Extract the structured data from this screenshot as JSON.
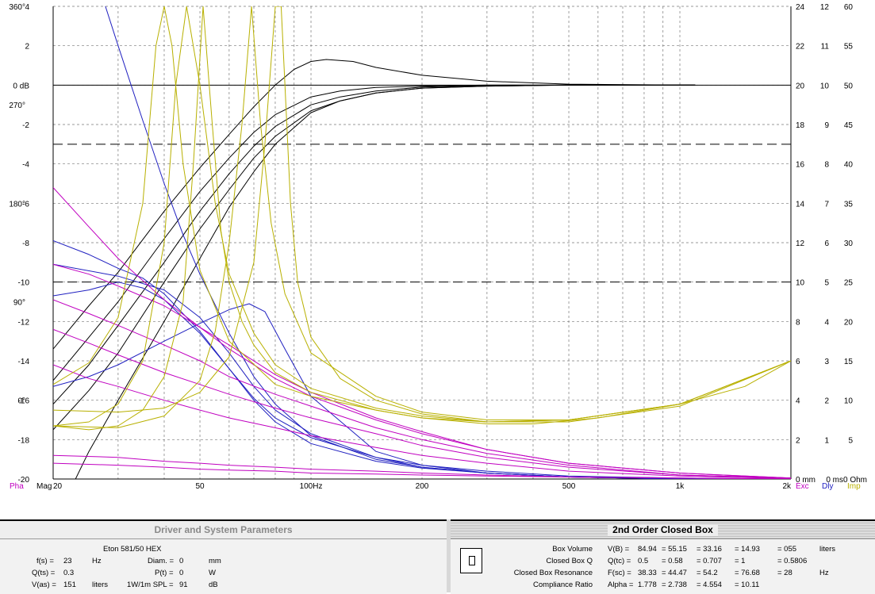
{
  "chart_data": {
    "type": "line",
    "x_scale": "log",
    "xlim": [
      20,
      2000
    ],
    "left_axis_mag_db": {
      "ylim": [
        -20,
        4
      ],
      "ticks": [
        "4",
        "2",
        "0 dB",
        "-2",
        "-4",
        "-6",
        "-8",
        "-10",
        "-12",
        "-14",
        "-16",
        "-18",
        "-20"
      ]
    },
    "left_axis_phase": {
      "ticks": [
        "360°",
        "270°",
        "180°",
        "90°",
        "0°"
      ]
    },
    "right_axis_excursion": {
      "ticks": [
        "24",
        "22",
        "20",
        "18",
        "16",
        "14",
        "12",
        "10",
        "8",
        "6",
        "4",
        "2",
        "0 mm"
      ]
    },
    "right_axis_delay": {
      "ticks": [
        "12",
        "11",
        "10",
        "9",
        "8",
        "7",
        "6",
        "5",
        "4",
        "3",
        "2",
        "1",
        "0 ms"
      ]
    },
    "right_axis_impedance": {
      "ticks": [
        "60",
        "55",
        "50",
        "45",
        "40",
        "35",
        "30",
        "25",
        "20",
        "15",
        "10",
        "5",
        "0 Ohm"
      ]
    },
    "x_ticks": [
      "20",
      "50",
      "100Hz",
      "200",
      "500",
      "1k",
      "2k"
    ],
    "axis_codes": {
      "pha": "Pha",
      "mag": "Mag",
      "exc": "Exc",
      "dly": "Dly",
      "imp": "Imp"
    },
    "colors": {
      "mag": "#000000",
      "delay": "#2020c0",
      "phase": "#c000c0",
      "impedance": "#b8b000",
      "grid": "#777777"
    },
    "reference_lines_db": [
      0,
      -3,
      -10
    ],
    "series": [
      {
        "kind": "magnitude",
        "x": [
          20,
          25,
          30,
          40,
          50,
          60,
          70,
          80,
          100,
          120,
          150,
          200,
          300,
          500,
          1000,
          1100
        ],
        "y": [
          -17.5,
          -15.5,
          -13.6,
          -10,
          -7.3,
          -5.3,
          -3.7,
          -2.6,
          -1.3,
          -0.8,
          -0.4,
          -0.15,
          -0.05,
          0,
          0,
          0
        ]
      },
      {
        "kind": "magnitude",
        "x": [
          20,
          25,
          30,
          40,
          50,
          60,
          70,
          80,
          100,
          120,
          150,
          200,
          300,
          500,
          1000,
          1100
        ],
        "y": [
          -16.2,
          -14.2,
          -12.2,
          -9,
          -6.4,
          -4.5,
          -3.1,
          -2.1,
          -1,
          -0.6,
          -0.3,
          -0.1,
          -0.03,
          0,
          0,
          0
        ]
      },
      {
        "kind": "magnitude",
        "x": [
          20,
          25,
          30,
          40,
          50,
          60,
          70,
          80,
          100,
          120,
          150,
          200,
          300,
          500,
          1000,
          1100
        ],
        "y": [
          -15,
          -12.8,
          -11,
          -7.8,
          -5.4,
          -3.7,
          -2.4,
          -1.5,
          -0.6,
          -0.3,
          -0.12,
          -0.05,
          0,
          0,
          0,
          0
        ]
      },
      {
        "kind": "magnitude",
        "x": [
          20,
          25,
          30,
          40,
          50,
          60,
          70,
          80,
          90,
          100,
          110,
          130,
          150,
          200,
          300,
          500,
          1000,
          1100
        ],
        "y": [
          -13.4,
          -11.2,
          -9.5,
          -6.4,
          -4.2,
          -2.5,
          -1.1,
          0,
          0.8,
          1.2,
          1.3,
          1.2,
          0.9,
          0.5,
          0.2,
          0.05,
          0,
          0
        ]
      },
      {
        "kind": "magnitude",
        "x": [
          23,
          25,
          30,
          40,
          50,
          60,
          70,
          80,
          100,
          120,
          150,
          200,
          300,
          500,
          1000,
          1100
        ],
        "y": [
          -20,
          -18.6,
          -16,
          -12,
          -8.8,
          -6.2,
          -4.4,
          -3,
          -1.4,
          -0.8,
          -0.4,
          -0.15,
          -0.05,
          0,
          0,
          0
        ]
      },
      {
        "kind": "delay",
        "x": [
          20,
          25,
          30,
          35,
          40,
          50,
          60,
          70,
          80,
          100,
          150,
          200,
          300,
          500,
          1000,
          2000
        ],
        "y": [
          -7.9,
          -8.6,
          -9.3,
          -9.8,
          -10.6,
          -12.5,
          -14.4,
          -15.9,
          -16.9,
          -17.9,
          -18.9,
          -19.3,
          -19.6,
          -19.85,
          -19.95,
          -20
        ]
      },
      {
        "kind": "delay",
        "x": [
          20,
          25,
          30,
          35,
          40,
          50,
          60,
          70,
          80,
          100,
          150,
          200,
          300,
          500,
          1000,
          2000
        ],
        "y": [
          -10.7,
          -10.4,
          -10,
          -10.3,
          -10.9,
          -12.6,
          -14.4,
          -16,
          -17.1,
          -18.2,
          -19.1,
          -19.45,
          -19.7,
          -19.9,
          -20,
          -20
        ]
      },
      {
        "kind": "delay",
        "x": [
          20,
          25,
          30,
          40,
          50,
          60,
          68,
          75,
          85,
          100,
          150,
          200,
          300,
          500,
          1000,
          2000
        ],
        "y": [
          -15.3,
          -14.8,
          -14.2,
          -13,
          -12.1,
          -11.4,
          -11.1,
          -11.5,
          -13.4,
          -15.8,
          -18.6,
          -19.3,
          -19.7,
          -19.9,
          -20,
          -20
        ]
      },
      {
        "kind": "delay",
        "x": [
          20,
          30,
          40,
          50,
          60,
          70,
          80,
          100,
          150,
          200,
          300,
          500,
          1000,
          2000
        ],
        "y": [
          -9.1,
          -9.7,
          -10.4,
          -11.8,
          -13.6,
          -15.3,
          -16.5,
          -17.7,
          -18.9,
          -19.4,
          -19.7,
          -19.9,
          -20,
          -20
        ]
      },
      {
        "kind": "delay",
        "x": [
          27.5,
          30,
          35,
          40,
          45,
          50,
          60,
          70,
          80,
          100,
          150,
          200,
          300,
          500,
          1000,
          2000
        ],
        "y": [
          4.2,
          2,
          -1.8,
          -5,
          -7.6,
          -9.6,
          -12.6,
          -14.8,
          -16.2,
          -17.8,
          -19,
          -19.4,
          -19.7,
          -19.9,
          -20,
          -20
        ]
      },
      {
        "kind": "phase",
        "x": [
          20,
          25,
          30,
          40,
          50,
          60,
          80,
          100,
          150,
          200,
          300,
          500,
          1000,
          2000
        ],
        "y": [
          -5.2,
          -7.2,
          -8.8,
          -10.9,
          -12.3,
          -13.4,
          -14.9,
          -15.8,
          -17,
          -17.7,
          -18.5,
          -19.2,
          -19.7,
          -19.95
        ]
      },
      {
        "kind": "phase",
        "x": [
          20,
          25,
          30,
          40,
          50,
          60,
          80,
          100,
          150,
          200,
          300,
          500,
          1000,
          2000
        ],
        "y": [
          -9.1,
          -9.6,
          -10.2,
          -11.2,
          -12.3,
          -13.2,
          -14.7,
          -15.6,
          -16.9,
          -17.6,
          -18.5,
          -19.2,
          -19.7,
          -19.95
        ]
      },
      {
        "kind": "phase",
        "x": [
          20,
          25,
          30,
          40,
          50,
          60,
          80,
          100,
          150,
          200,
          300,
          500,
          1000,
          2000
        ],
        "y": [
          -10.9,
          -11.6,
          -12.2,
          -13.2,
          -14,
          -14.8,
          -15.7,
          -16.3,
          -17.4,
          -18,
          -18.7,
          -19.3,
          -19.8,
          -19.95
        ]
      },
      {
        "kind": "phase",
        "x": [
          20,
          25,
          30,
          40,
          50,
          60,
          80,
          100,
          150,
          200,
          300,
          500,
          1000,
          2000
        ],
        "y": [
          -12.4,
          -13.1,
          -13.7,
          -14.6,
          -15.2,
          -15.7,
          -16.4,
          -16.9,
          -17.7,
          -18.3,
          -18.9,
          -19.4,
          -19.8,
          -19.95
        ]
      },
      {
        "kind": "phase",
        "x": [
          20,
          25,
          30,
          40,
          50,
          60,
          80,
          100,
          150,
          200,
          300,
          500,
          1000,
          2000
        ],
        "y": [
          -14.2,
          -14.9,
          -15.3,
          -16,
          -16.5,
          -16.9,
          -17.4,
          -17.8,
          -18.4,
          -18.8,
          -19.2,
          -19.6,
          -19.85,
          -19.98
        ]
      },
      {
        "kind": "phase",
        "x": [
          20,
          30,
          40,
          50,
          60,
          80,
          100,
          150,
          200,
          300,
          500,
          1000,
          2000
        ],
        "y": [
          -18.8,
          -18.9,
          -19.1,
          -19.2,
          -19.3,
          -19.4,
          -19.5,
          -19.6,
          -19.7,
          -19.8,
          -19.9,
          -19.95,
          -20
        ]
      },
      {
        "kind": "phase",
        "x": [
          20,
          30,
          40,
          50,
          60,
          80,
          100,
          150,
          200,
          300,
          500,
          1000,
          2000
        ],
        "y": [
          -19.2,
          -19.3,
          -19.4,
          -19.5,
          -19.55,
          -19.6,
          -19.7,
          -19.75,
          -19.8,
          -19.85,
          -19.9,
          -19.95,
          -20
        ]
      },
      {
        "kind": "impedance",
        "x": [
          20,
          25,
          30,
          35,
          38,
          40,
          42,
          45,
          50,
          60,
          80,
          100,
          150,
          200,
          300,
          400,
          600,
          1000,
          1500,
          2000
        ],
        "y": [
          -15.2,
          -14.1,
          -11.8,
          -6,
          2,
          4,
          2,
          -4,
          -9.4,
          -13,
          -15.2,
          -15.8,
          -16.5,
          -16.9,
          -17.2,
          -17.2,
          -16.9,
          -16.2,
          -15.3,
          -14
        ]
      },
      {
        "kind": "impedance",
        "x": [
          20,
          25,
          30,
          35,
          40,
          43,
          46,
          50,
          55,
          60,
          70,
          80,
          100,
          150,
          200,
          300,
          500,
          1000,
          2000
        ],
        "y": [
          -17.3,
          -17.1,
          -16.2,
          -14,
          -8,
          0,
          4,
          0,
          -6,
          -9.6,
          -12.6,
          -14.2,
          -15.4,
          -16.4,
          -16.8,
          -17.1,
          -17,
          -16.2,
          -14
        ]
      },
      {
        "kind": "impedance",
        "x": [
          20,
          25,
          30,
          35,
          40,
          45,
          48,
          51,
          54,
          57,
          60,
          65,
          70,
          80,
          100,
          150,
          200,
          300,
          500,
          1000,
          2000
        ],
        "y": [
          -17.3,
          -17.5,
          -17.3,
          -16.5,
          -14.8,
          -11,
          -4,
          4,
          -2,
          -7.4,
          -10,
          -12,
          -13.2,
          -14.6,
          -15.6,
          -16.5,
          -16.9,
          -17.1,
          -17,
          -16.2,
          -14
        ]
      },
      {
        "kind": "impedance",
        "x": [
          20,
          30,
          40,
          50,
          55,
          60,
          65,
          69,
          73,
          78,
          85,
          100,
          150,
          200,
          300,
          500,
          1000,
          2000
        ],
        "y": [
          -17.3,
          -17.4,
          -16.8,
          -15,
          -12.5,
          -8,
          -2,
          4,
          -2,
          -7,
          -10.6,
          -13.6,
          -15.8,
          -16.6,
          -17,
          -17,
          -16.2,
          -14
        ]
      },
      {
        "kind": "impedance",
        "x": [
          20,
          30,
          40,
          50,
          60,
          70,
          75,
          80,
          83,
          85,
          88,
          92,
          100,
          120,
          150,
          200,
          300,
          500,
          1000,
          2000
        ],
        "y": [
          -16.5,
          -16.6,
          -16.4,
          -15.6,
          -13.8,
          -9,
          -3,
          4,
          4,
          0,
          -6,
          -10,
          -12.8,
          -14.9,
          -16,
          -16.7,
          -17.1,
          -17.1,
          -16.3,
          -14
        ]
      }
    ]
  },
  "left_panel": {
    "title": "Driver and System Parameters",
    "driver_name": "Eton  581/50 HEX",
    "fs_label": "f(s) =",
    "fs_value": "23",
    "fs_unit": "Hz",
    "qts_label": "Q(ts) =",
    "qts_value": "0.3",
    "vas_label": "V(as) =",
    "vas_value": "151",
    "vas_unit": "liters",
    "diam_label": "Diam. =",
    "diam_value": "0",
    "diam_unit": "mm",
    "pt_label": "P(t) =",
    "pt_value": "0",
    "pt_unit": "W",
    "spl_label": "1W/1m SPL =",
    "spl_value": "91",
    "spl_unit": "dB"
  },
  "right_panel": {
    "title": "2nd Order Closed Box",
    "rows": [
      {
        "label": "Box Volume",
        "sym": "V(B) =",
        "v1": "84.94",
        "v2": "= 55.15",
        "v3": "= 33.16",
        "v4": "= 14.93",
        "v5": "= 055",
        "unit": "liters"
      },
      {
        "label": "Closed Box Q",
        "sym": "Q(tc) =",
        "v1": "0.5",
        "v2": "= 0.58",
        "v3": "= 0.707",
        "v4": "= 1",
        "v5": "= 0.5806",
        "unit": ""
      },
      {
        "label": "Closed Box Resonance",
        "sym": "F(sc) =",
        "v1": "38.33",
        "v2": "= 44.47",
        "v3": "= 54.2",
        "v4": "= 76.68",
        "v5": "= 28",
        "unit": "Hz"
      },
      {
        "label": "Compliance Ratio",
        "sym": "Alpha =",
        "v1": "1.778",
        "v2": "= 2.738",
        "v3": "= 4.554",
        "v4": "= 10.11",
        "v5": "",
        "unit": ""
      }
    ]
  }
}
